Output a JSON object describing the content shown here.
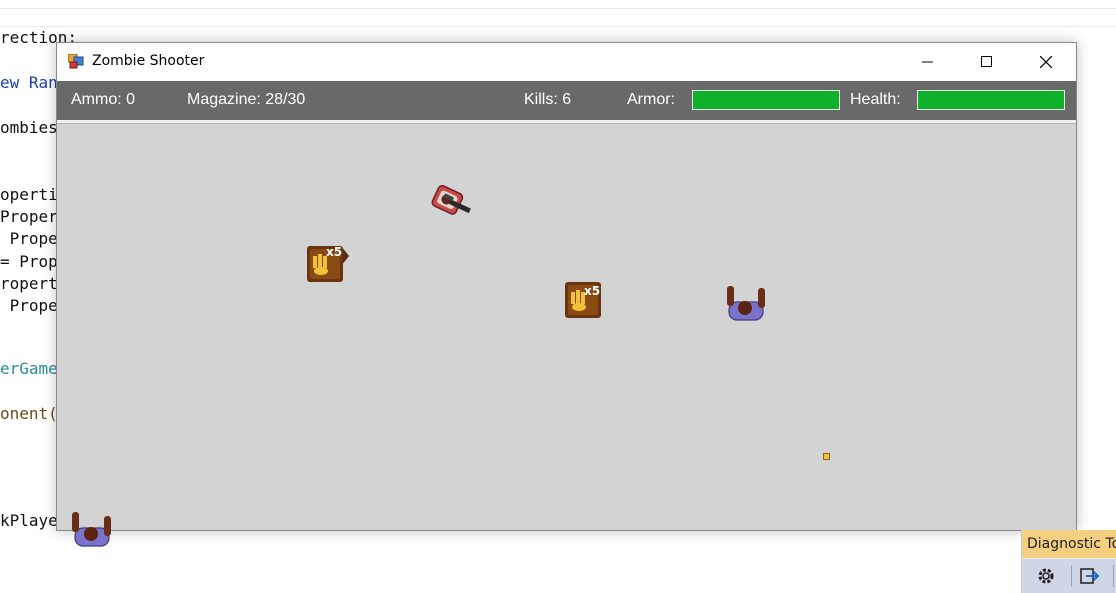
{
  "background_code": {
    "lines": [
      {
        "text": "rection;",
        "style": "plain"
      },
      {
        "text": "ew Ranc",
        "style": "kw"
      },
      {
        "text": "ombies",
        "style": "plain"
      },
      {
        "text": "opertie",
        "style": "plain"
      },
      {
        "text": "Propert",
        "style": "plain"
      },
      {
        "text": " Proper",
        "style": "plain"
      },
      {
        "text": "= Propo",
        "style": "plain"
      },
      {
        "text": "ropert",
        "style": "plain"
      },
      {
        "text": " Proper",
        "style": "plain"
      },
      {
        "text": "erGame",
        "style": "teal"
      },
      {
        "text": "onent(",
        "style": "brown"
      },
      {
        "text": "kPlaye",
        "style": "plain"
      }
    ]
  },
  "window": {
    "title": "Zombie Shooter",
    "controls": {
      "minimize": "minimize",
      "maximize": "maximize",
      "close": "close"
    }
  },
  "hud": {
    "ammo": "Ammo: 0",
    "magazine": "Magazine: 28/30",
    "kills": "Kills: 6",
    "armor_label": "Armor:",
    "armor_value": 1.0,
    "health_label": "Health:",
    "health_value": 1.0,
    "bar_color": "#0fb12a",
    "hud_color": "#696969",
    "field_color": "#d3d3d3"
  },
  "game_objects": {
    "player": {
      "icon": "player-with-gun-icon"
    },
    "zombies": [
      {
        "icon": "zombie-icon"
      },
      {
        "icon": "zombie-icon"
      },
      {
        "icon": "zombie-icon"
      }
    ],
    "ammo_pickups": [
      {
        "icon": "ammo-crate-icon",
        "label": "x5"
      },
      {
        "icon": "ammo-crate-icon",
        "label": "x5"
      }
    ],
    "bullet": {
      "icon": "bullet-icon"
    }
  },
  "diagnostic_tools": {
    "title": "Diagnostic To",
    "tools": [
      {
        "icon": "gear-icon"
      },
      {
        "icon": "export-icon"
      }
    ]
  }
}
